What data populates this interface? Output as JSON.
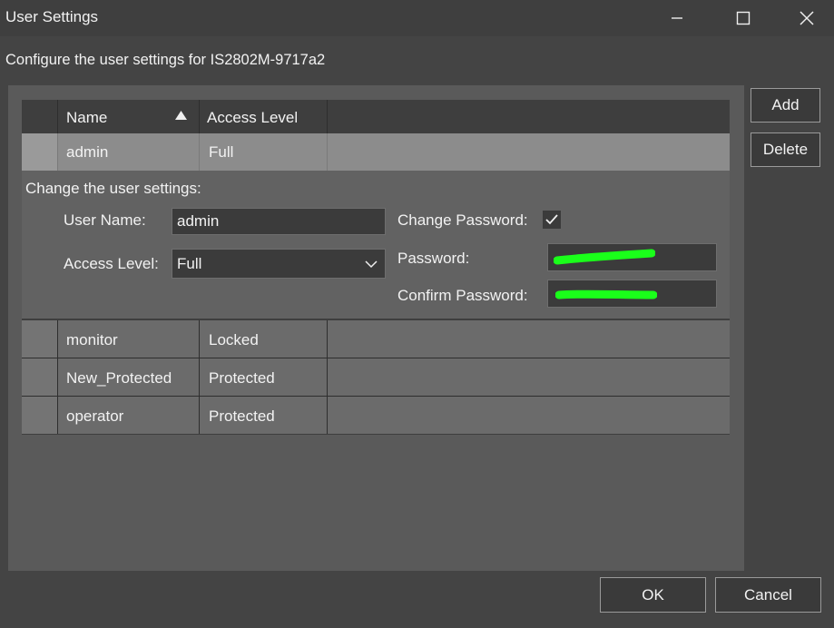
{
  "window": {
    "title": "User Settings",
    "subtitle": "Configure the user settings for IS2802M-9717a2"
  },
  "table": {
    "columns": {
      "name": "Name",
      "access": "Access Level"
    },
    "selected_row": {
      "name": "admin",
      "access": "Full"
    },
    "other_rows": [
      {
        "name": "monitor",
        "access": "Locked"
      },
      {
        "name": "New_Protected",
        "access": "Protected"
      },
      {
        "name": "operator",
        "access": "Protected"
      }
    ]
  },
  "detail": {
    "heading": "Change the user settings:",
    "username_label": "User Name:",
    "username_value": "admin",
    "access_label": "Access Level:",
    "access_value": "Full",
    "change_password_label": "Change Password:",
    "change_password_checked": true,
    "password_label": "Password:",
    "confirm_label": "Confirm Password:"
  },
  "buttons": {
    "add": "Add",
    "delete": "Delete",
    "ok": "OK",
    "cancel": "Cancel"
  },
  "colors": {
    "redaction": "#1aff1a",
    "selected_row": "#8c8c8c"
  },
  "icons": {
    "minimize": "minimize-icon",
    "maximize": "maximize-icon",
    "close": "close-icon",
    "sort": "sort-ascending-icon",
    "dropdown": "chevron-down-icon",
    "checkmark": "checkmark-icon"
  }
}
